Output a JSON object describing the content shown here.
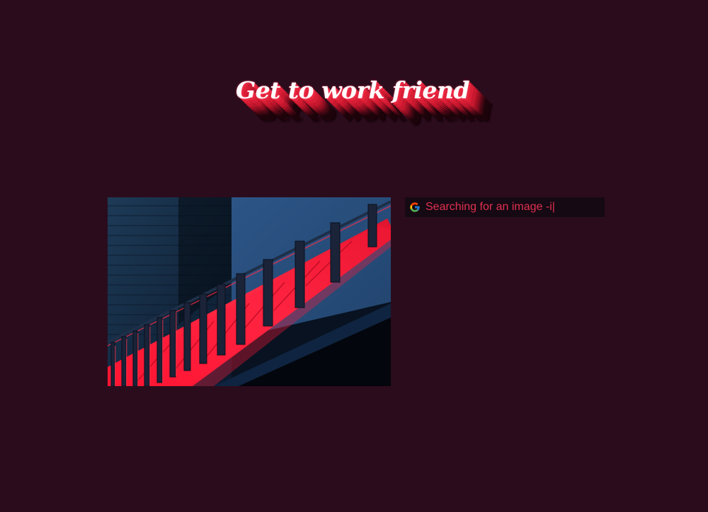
{
  "header": {
    "title": "Get to work friend"
  },
  "photo": {
    "subject": "neon-red-staircase"
  },
  "search": {
    "icon": "google-g-icon",
    "value": "Searching for an image -i|"
  },
  "colors": {
    "background": "#2b0c1c",
    "accent": "#e0304f",
    "search_bg": "#150913",
    "title_text": "#ffffff"
  }
}
